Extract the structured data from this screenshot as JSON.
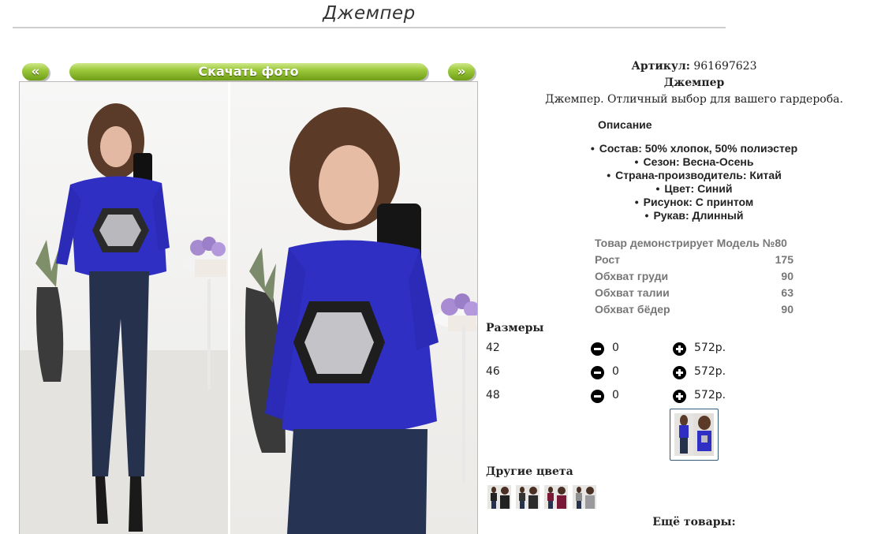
{
  "page": {
    "title": "Джемпер"
  },
  "gallery": {
    "prev_label": "«",
    "download_label": "Скачать фото",
    "next_label": "»"
  },
  "product": {
    "article_label": "Артикул:",
    "article_value": "961697623",
    "name": "Джемпер",
    "description": "Джемпер. Отличный выбор для вашего гардероба.",
    "description_heading": "Описание",
    "specs": [
      "Состав: 50% хлопок, 50% полиэстер",
      "Сезон: Весна-Осень",
      "Страна-производитель: Китай",
      "Цвет: Синий",
      "Рисунок: С принтом",
      "Рукав: Длинный"
    ]
  },
  "model": {
    "rows": [
      {
        "label": "Товар демонстрирует Модель №80",
        "value": ""
      },
      {
        "label": "Рост",
        "value": "175"
      },
      {
        "label": "Обхват груди",
        "value": "90"
      },
      {
        "label": "Обхват талии",
        "value": "63"
      },
      {
        "label": "Обхват бёдер",
        "value": "90"
      }
    ]
  },
  "sizes": {
    "heading": "Размеры",
    "items": [
      {
        "size": "42",
        "qty": "0",
        "price": "572р."
      },
      {
        "size": "46",
        "qty": "0",
        "price": "572р."
      },
      {
        "size": "48",
        "qty": "0",
        "price": "572р."
      }
    ]
  },
  "colors": {
    "heading": "Другие цвета"
  },
  "more": {
    "heading": "Ещё товары:"
  },
  "accent": {
    "button_green": "#8ebf2e",
    "sweater_blue": "#2f2fc4"
  }
}
